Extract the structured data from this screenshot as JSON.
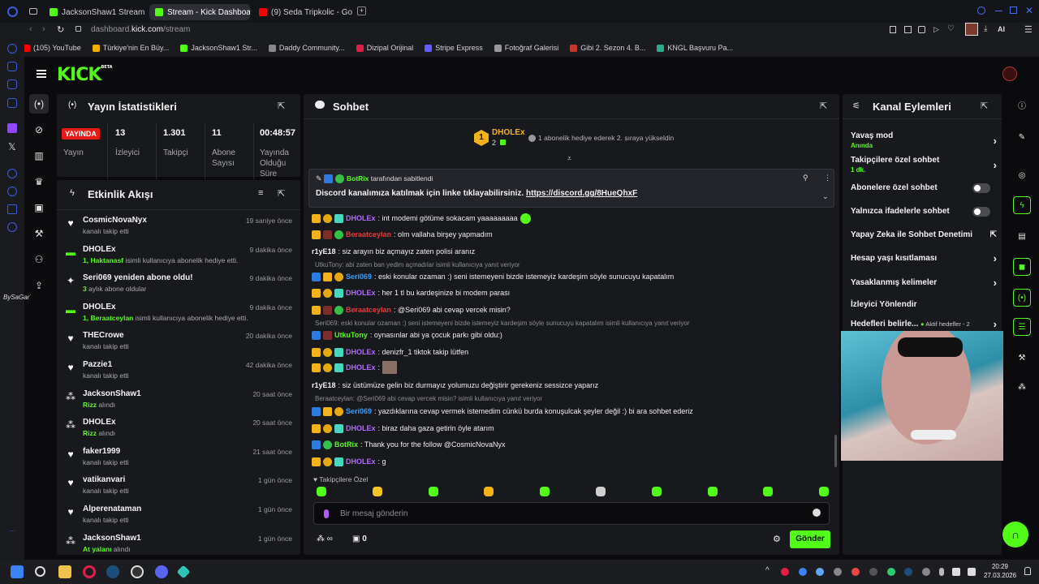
{
  "browser": {
    "tabs": [
      {
        "label": "JacksonShaw1 Stream - W",
        "active": false
      },
      {
        "label": "Stream - Kick Dashboard",
        "active": true
      },
      {
        "label": "(9) Seda Tripkolic - Go",
        "active": false
      }
    ],
    "url_prefix": "dashboard.",
    "url_domain": "kick.com",
    "url_path": "/stream",
    "ai_label": "AI",
    "bookmarks": [
      {
        "label": "(105) YouTube",
        "color": "#ff0000"
      },
      {
        "label": "Türkiye'nin En Büy...",
        "color": "#f0b000"
      },
      {
        "label": "JacksonShaw1 Str...",
        "color": "#53fc18"
      },
      {
        "label": "Daddy Community...",
        "color": "#888888"
      },
      {
        "label": "Dizipal Orijinal",
        "color": "#e11d48"
      },
      {
        "label": "Stripe Express",
        "color": "#635bff"
      },
      {
        "label": "Fotoğraf Galerisi",
        "color": "#999999"
      },
      {
        "label": "Gibi 2. Sezon 4. B...",
        "color": "#c0392b"
      },
      {
        "label": "KNGL Başvuru Pa...",
        "color": "#2fa88c"
      }
    ]
  },
  "kick": {
    "logo": "KICK",
    "logo_badge": "BETA",
    "watermark": "BySaGarT"
  },
  "stats": {
    "title": "Yayın İstatistikleri",
    "live_badge": "YAYINDA",
    "items": [
      {
        "value": "",
        "label": "Yayın"
      },
      {
        "value": "13",
        "label": "İzleyici"
      },
      {
        "value": "1.301",
        "label": "Takipçi"
      },
      {
        "value": "11",
        "label": "Abone Sayısı"
      },
      {
        "value": "00:48:57",
        "label": "Yayında Olduğu Süre"
      }
    ]
  },
  "activity": {
    "title": "Etkinlik Akışı",
    "items": [
      {
        "icon": "heart",
        "name": "CosmicNovaNyx",
        "highlight": "",
        "sub": "kanalı takip etti",
        "time": "19 saniye önce"
      },
      {
        "icon": "gift",
        "name": "DHOLEx",
        "highlight": "1, Haktanasf",
        "sub": " isimli kullanıcıya abonelik hediye etti.",
        "time": "9 dakika önce"
      },
      {
        "icon": "star",
        "name": "Seri069 yeniden abone oldu!",
        "highlight": "3",
        "sub": " aylık abone oldular",
        "time": "9 dakika önce"
      },
      {
        "icon": "gift",
        "name": "DHOLEx",
        "highlight": "1, Beraatceylan",
        "sub": " isimli kullanıcıya abonelik hediye etti.",
        "time": "9 dakika önce"
      },
      {
        "icon": "heart",
        "name": "THECrowe",
        "highlight": "",
        "sub": "kanalı takip etti",
        "time": "20 dakika önce"
      },
      {
        "icon": "heart",
        "name": "Pazzie1",
        "highlight": "",
        "sub": "kanalı takip etti",
        "time": "42 dakika önce"
      },
      {
        "icon": "reward",
        "name": "JacksonShaw1",
        "highlight": "Rizz",
        "sub": " alındı",
        "time": "20 saat önce"
      },
      {
        "icon": "reward",
        "name": "DHOLEx",
        "highlight": "Rizz",
        "sub": " alındı",
        "time": "20 saat önce"
      },
      {
        "icon": "heart",
        "name": "faker1999",
        "highlight": "",
        "sub": "kanalı takip etti",
        "time": "21 saat önce"
      },
      {
        "icon": "heart",
        "name": "vatikanvari",
        "highlight": "",
        "sub": "kanalı takip etti",
        "time": "1 gün önce"
      },
      {
        "icon": "heart",
        "name": "Alperenataman",
        "highlight": "",
        "sub": "kanalı takip etti",
        "time": "1 gün önce"
      },
      {
        "icon": "reward",
        "name": "JacksonShaw1",
        "highlight": "At yalanı",
        "sub": " alındı",
        "time": "1 gün önce"
      }
    ]
  },
  "chat": {
    "title": "Sohbet",
    "top_gifter": {
      "name": "DHOLEx",
      "rank": "1",
      "count": "2",
      "note": "1 abonelik hediye ederek 2. sıraya yükseldin"
    },
    "pinned": {
      "by": "BotRix",
      "by_suffix": " tarafından sabitlendi",
      "text": "Discord kanalımıza katılmak için linke tıklayabilirsiniz. ",
      "link": "https://discord.gg/8HueQhxF"
    },
    "messages": [
      {
        "badges": [
          "b1",
          "b2",
          "b3"
        ],
        "user": "DHOLEx",
        "color": "#b26bff",
        "text": ": int modemi götüme sokacam yaaaaaaaaa",
        "emote": true
      },
      {
        "badges": [
          "b1",
          "b6",
          "b5"
        ],
        "user": "Beraatceylan",
        "color": "#e63b3b",
        "text": ": olm vallaha birşey yapmadım"
      },
      {
        "badges": [],
        "user": "r1yE18",
        "color": "#f2f2f2",
        "text": ": siz arayın biz açmayız zaten polisi aranız"
      },
      {
        "reply": "UtkuTony: abi zaten ban yedim açmadılar isimli kullanıcıya yanıt veriyor"
      },
      {
        "badges": [
          "b4",
          "b1",
          "b2"
        ],
        "user": "Seri069",
        "color": "#3ba1ff",
        "text": ": eski konular ozaman :) seni istemeyeni bizde istemeyiz kardeşim söyle sunucuyu kapatalım"
      },
      {
        "badges": [
          "b1",
          "b2",
          "b3"
        ],
        "user": "DHOLEx",
        "color": "#b26bff",
        "text": ": her 1 tl bu kardeşinize bi modem parası"
      },
      {
        "badges": [
          "b1",
          "b6",
          "b5"
        ],
        "user": "Beraatceylan",
        "color": "#e63b3b",
        "text": ": @Seri069 abi cevap vercek misin?"
      },
      {
        "reply": "Seri069: eski konular ozaman :) seni istemeyeni bizde istemeyiz kardeşim söyle sunucuyu kapatalım isimli kullanıcıya yanıt veriyor"
      },
      {
        "badges": [
          "b4",
          "b6"
        ],
        "user": "UtkuTony",
        "color": "#53fc18",
        "text": ": oynasınlar abi ya çocuk parkı gibi oldu:)"
      },
      {
        "badges": [
          "b1",
          "b2",
          "b3"
        ],
        "user": "DHOLEx",
        "color": "#b26bff",
        "text": ": denizfr_1 tiktok takip lütfen"
      },
      {
        "badges": [
          "b1",
          "b2",
          "b3"
        ],
        "user": "DHOLEx",
        "color": "#b26bff",
        "text": ":",
        "img": true
      },
      {
        "badges": [],
        "user": "r1yE18",
        "color": "#f2f2f2",
        "text": ": siz üstümüze gelin biz durmayız yolumuzu değiştirir gerekeniz sessizce yaparız"
      },
      {
        "reply": "Beraatceylan: @Seri069 abi cevap vercek misin? isimli kullanıcıya yanıt veriyor"
      },
      {
        "badges": [
          "b4",
          "b1",
          "b2"
        ],
        "user": "Seri069",
        "color": "#3ba1ff",
        "text": ": yazdıklarına cevap vermek istemedim cünkü burda konuşulcak şeyler değil :) bi ara sohbet ederiz"
      },
      {
        "badges": [
          "b1",
          "b2",
          "b3"
        ],
        "user": "DHOLEx",
        "color": "#b26bff",
        "text": ": biraz daha gaza getirin öyle atarım"
      },
      {
        "badges": [
          "b4",
          "b5"
        ],
        "user": "BotRix",
        "color": "#53fc18",
        "text": ": Thank you for the follow @CosmicNovaNyx"
      },
      {
        "badges": [
          "b1",
          "b2",
          "b3"
        ],
        "user": "DHOLEx",
        "color": "#b26bff",
        "text": ": g"
      }
    ],
    "followers_only": "Takipçilere Özel",
    "input_placeholder": "Bir mesaj gönderin",
    "points": "∞",
    "gift_count": "0",
    "send_label": "Gönder"
  },
  "channel": {
    "title": "Kanal Eylemleri",
    "actions": [
      {
        "label": "Yavaş mod",
        "sub": "Anında",
        "control": "chevron"
      },
      {
        "label": "Takipçilere özel sohbet",
        "sub": "1 dk.",
        "control": "chevron"
      },
      {
        "label": "Abonelere özel sohbet",
        "sub": "",
        "control": "toggle"
      },
      {
        "label": "Yalnızca ifadelerle sohbet",
        "sub": "",
        "control": "toggle"
      },
      {
        "label": "Yapay Zeka ile Sohbet Denetimi",
        "sub": "",
        "control": "external"
      },
      {
        "label": "Hesap yaşı kısıtlaması",
        "sub": "",
        "control": "chevron"
      },
      {
        "label": "Yasaklanmış kelimeler",
        "sub": "",
        "control": "chevron"
      },
      {
        "label": "İzleyici Yönlendir",
        "sub": "",
        "control": "none"
      },
      {
        "label": "Hedefleri belirle...",
        "sub": "",
        "control": "chevron"
      }
    ],
    "goal_badge": "Aktif hedefler - 2"
  },
  "taskbar": {
    "time": "20:29",
    "date": "27.03.2026"
  }
}
